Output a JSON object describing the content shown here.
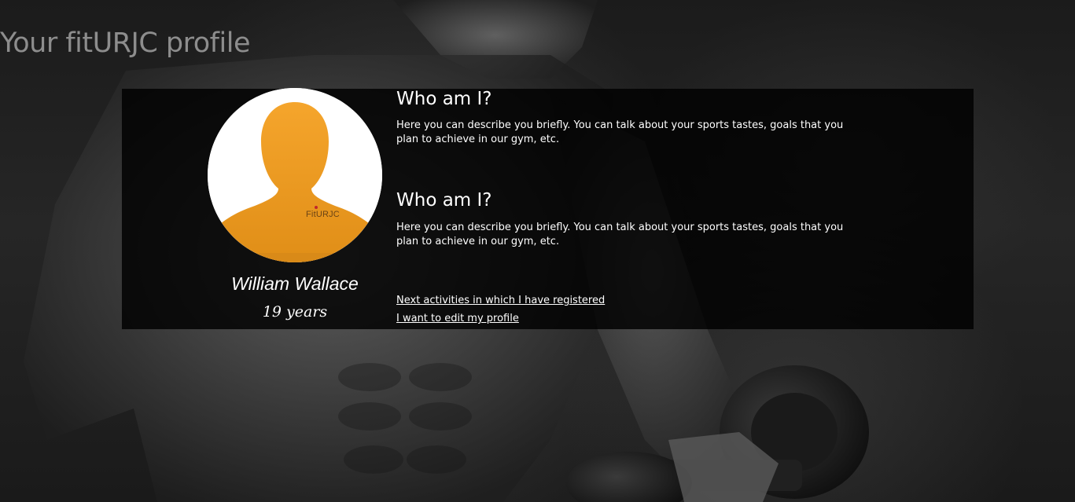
{
  "page": {
    "title": "Your fitURJC profile"
  },
  "profile": {
    "name": "William Wallace",
    "age": "19 years",
    "avatar_brand": "FitURJC"
  },
  "sections": [
    {
      "title": "Who am I?",
      "text": "Here you can describe you briefly. You can talk about your sports tastes, goals that you plan to achieve in our gym, etc."
    },
    {
      "title": "Who am I?",
      "text": "Here you can describe you briefly. You can talk about your sports tastes, goals that you plan to achieve in our gym, etc."
    }
  ],
  "links": {
    "next_activities": "Next activities in which I have registered",
    "edit_profile": "I want to edit my profile"
  },
  "colors": {
    "avatar_orange": "#f0a02a",
    "title_gray": "#8d8d8d",
    "panel_bg": "#000000"
  },
  "icons": {
    "avatar": "user-silhouette-icon",
    "background": "athlete-with-dumbbell-photo"
  }
}
